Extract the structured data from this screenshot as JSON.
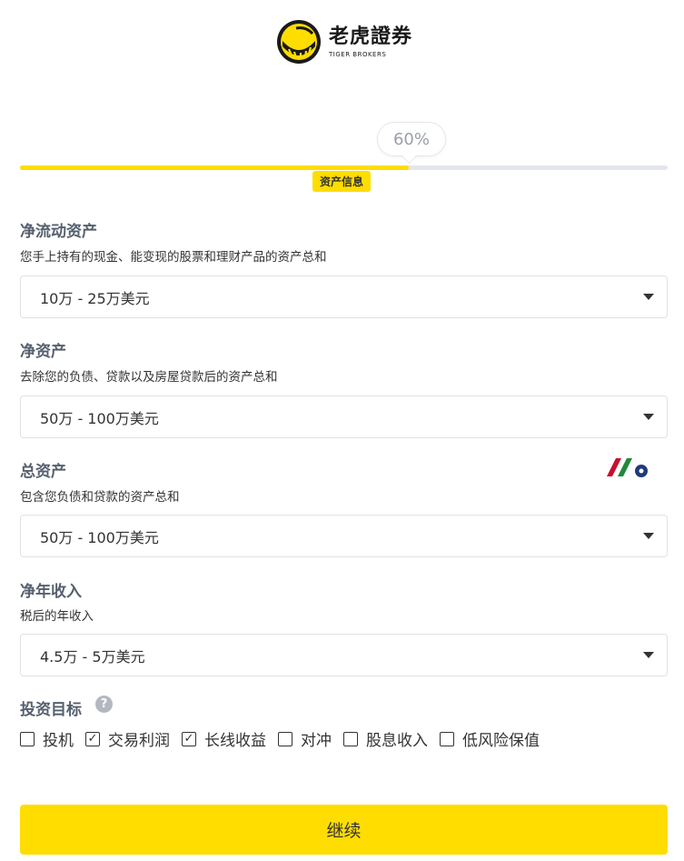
{
  "brand": {
    "name_cn": "老虎證券",
    "name_en": "TIGER BROKERS",
    "logo_icon": "tiger-stripe-logo-icon",
    "accent_color": "#ffdd00"
  },
  "progress": {
    "percent_label": "60%",
    "value": 0.6,
    "step_label": "资产信息"
  },
  "fields": [
    {
      "title": "净流动资产",
      "description": "您手上持有的现金、能变现的股票和理财产品的资产总和",
      "value": "10万 - 25万美元"
    },
    {
      "title": "净资产",
      "description": "去除您的负债、贷款以及房屋贷款后的资产总和",
      "value": "50万 - 100万美元"
    },
    {
      "title": "总资产",
      "description": "包含您负债和贷款的资产总和",
      "value": "50万 - 100万美元"
    },
    {
      "title": "净年收入",
      "description": "税后的年收入",
      "value": "4.5万 - 5万美元"
    }
  ],
  "investment_goals": {
    "title": "投资目标",
    "help_icon": "question-circle-icon",
    "options": [
      {
        "label": "投机",
        "checked": false
      },
      {
        "label": "交易利润",
        "checked": true
      },
      {
        "label": "长线收益",
        "checked": true
      },
      {
        "label": "对冲",
        "checked": false
      },
      {
        "label": "股息收入",
        "checked": false
      },
      {
        "label": "低风险保值",
        "checked": false
      }
    ]
  },
  "continue_label": "继续"
}
